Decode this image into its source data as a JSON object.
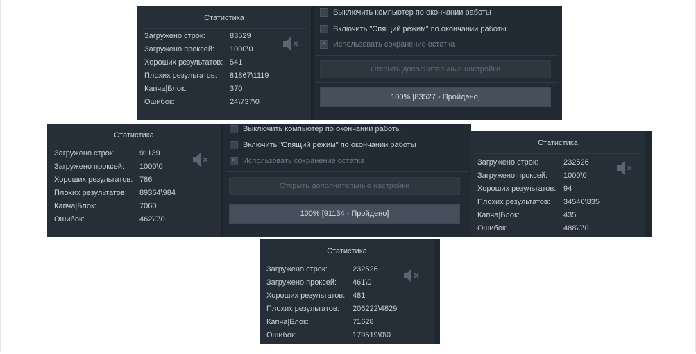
{
  "labels": {
    "stats_title": "Статистика",
    "rows": [
      "Загружено строк:",
      "Загружено проксей:",
      "Хороших результатов:",
      "Плохих результатов:",
      "Капча|Блок:",
      "Ошибок:"
    ],
    "opt_shutdown": "Выключить компьютер по окончании работы",
    "opt_sleep": "Включить \"Спящий режим\" по окончании работы",
    "opt_save_rest": "Использовать сохранение остатка",
    "btn_extra": "Открыть дополнительные настройки",
    "speaker_icon": "speaker-muted-icon",
    "disabled_check_icon": "x-mark-icon"
  },
  "colors": {
    "window_bg": "#222a33",
    "panel_bg": "#262e37",
    "text": "#c8ced6",
    "disabled_text": "#707a85"
  },
  "screenshots": [
    {
      "values": [
        "83529",
        "1000\\0",
        "541",
        "81867\\1119",
        "370",
        "24\\737\\0"
      ],
      "progress_text": "100% [83527 - Пройдено]",
      "progress_percent": 100
    },
    {
      "values": [
        "91139",
        "1000\\0",
        "786",
        "89364\\984",
        "7060",
        "462\\0\\0"
      ],
      "progress_text": "100% [91134 - Пройдено]",
      "progress_percent": 100
    },
    {
      "values": [
        "232526",
        "1000\\0",
        "94",
        "34540\\835",
        "435",
        "488\\0\\0"
      ]
    },
    {
      "values": [
        "232526",
        "461\\0",
        "481",
        "206222\\4829",
        "71628",
        "179519\\0\\0"
      ]
    }
  ]
}
